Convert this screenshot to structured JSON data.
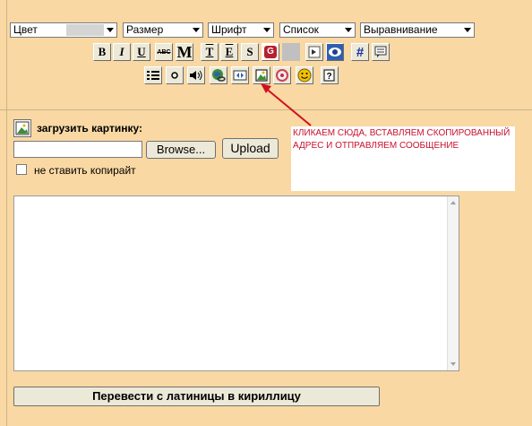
{
  "toolbar": {
    "selects": [
      {
        "label": "Цвет"
      },
      {
        "label": "Размер"
      },
      {
        "label": "Шрифт"
      },
      {
        "label": "Список"
      },
      {
        "label": "Выравнивание"
      }
    ],
    "row1": {
      "bold": "B",
      "italic": "I",
      "underline": "U",
      "strike": "ABC",
      "mono": "M",
      "t": "T",
      "e": "E",
      "s": "S",
      "g": "G",
      "hash": "#"
    }
  },
  "annotation": {
    "text": "КЛИКАЕМ СЮДА, ВСТАВЛЯЕМ СКОПИРОВАННЫЙ АДРЕС И ОТПРАВЛЯЕМ СООБЩЕНИЕ",
    "color": "#c8102e"
  },
  "upload": {
    "label": "загрузить картинку:",
    "browse_label": "Browse...",
    "upload_label": "Upload",
    "file_value": "",
    "no_copyright_label": "не ставить копирайт",
    "no_copyright_checked": false
  },
  "message": {
    "value": ""
  },
  "translit_button": "Перевести с латиницы в кириллицу"
}
